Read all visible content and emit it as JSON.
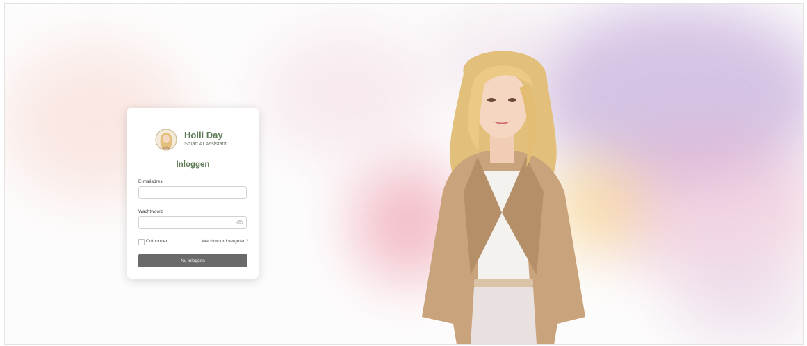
{
  "brand": {
    "name": "Holli Day",
    "tagline": "Smart AI Assistant"
  },
  "login": {
    "title": "Inloggen",
    "email_label": "E-mailadres",
    "email_value": "",
    "password_label": "Wachtwoord",
    "password_value": "",
    "remember_label": "Onthouden",
    "remember_checked": false,
    "forgot_label": "Wachtwoord vergeten?",
    "submit_label": "Nu inloggen"
  },
  "icons": {
    "brand": "avatar-logo-icon",
    "password_toggle": "eye-icon"
  },
  "colors": {
    "brand_green": "#5e7a55",
    "button": "#6a6a6a"
  }
}
